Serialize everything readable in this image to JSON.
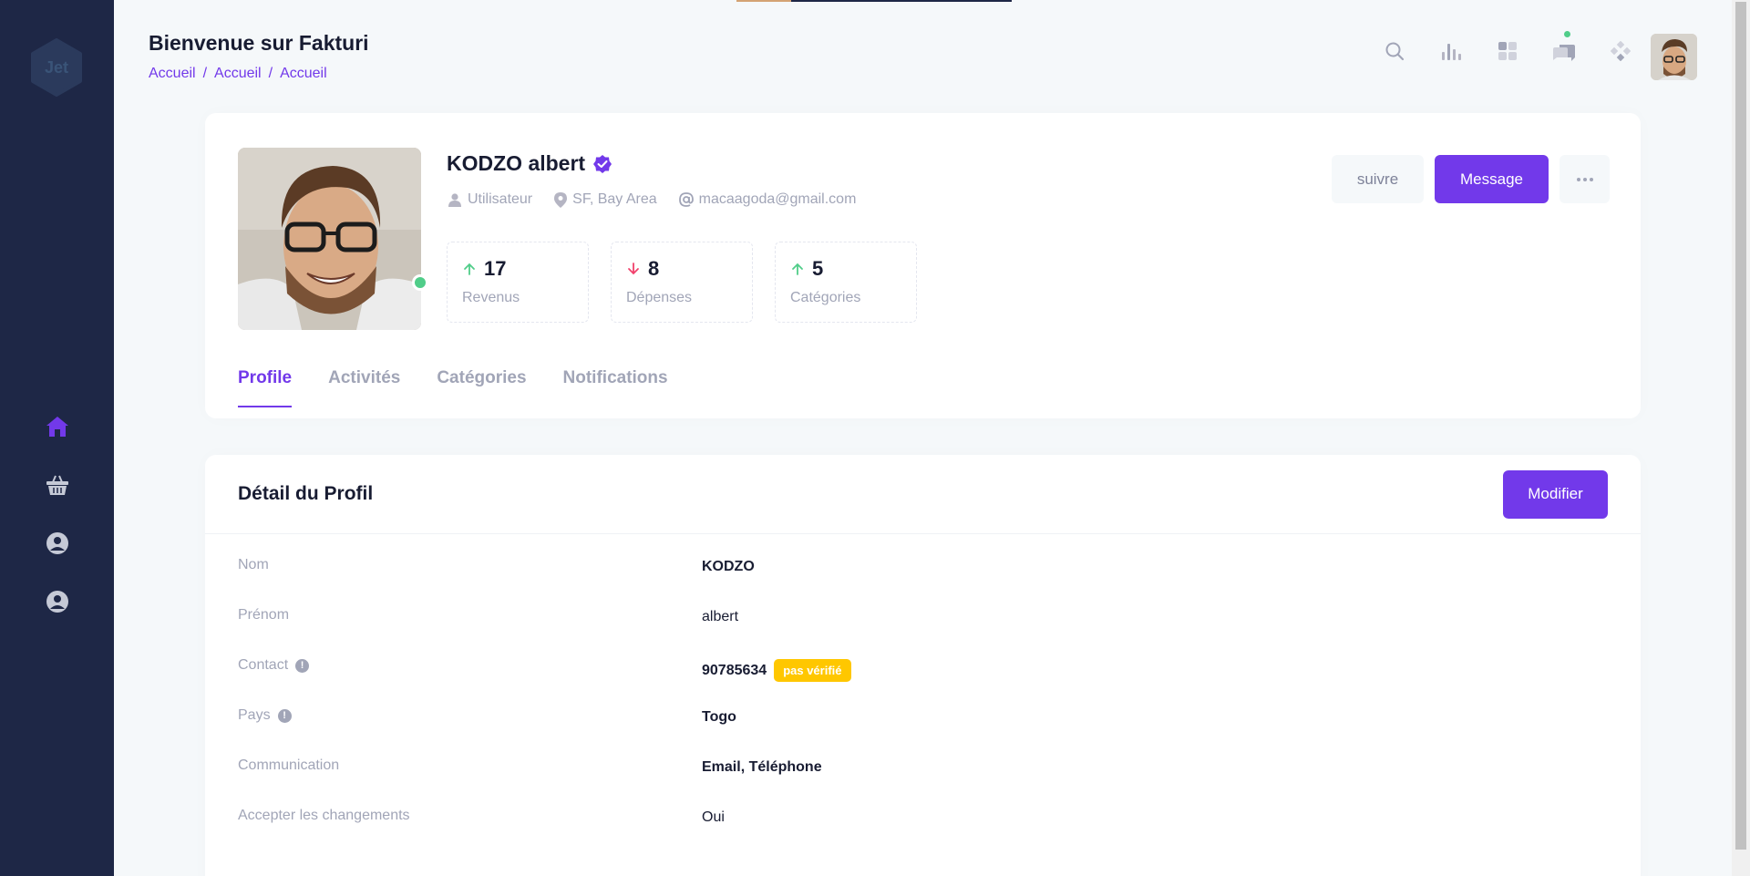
{
  "app": {
    "logo_text": "Jet"
  },
  "header": {
    "title": "Bienvenue sur Fakturi",
    "breadcrumb": [
      "Accueil",
      "Accueil",
      "Accueil"
    ]
  },
  "header_icons": [
    "search-icon",
    "chart-bar-icon",
    "grid-icon",
    "chat-icon",
    "diamond-apps-icon"
  ],
  "sidebar": {
    "items": [
      {
        "icon": "home-icon",
        "active": true
      },
      {
        "icon": "basket-icon",
        "active": false
      },
      {
        "icon": "circle-user-icon",
        "active": false
      },
      {
        "icon": "circle-user-icon",
        "active": false
      }
    ]
  },
  "profile": {
    "name": "KODZO albert",
    "role": "Utilisateur",
    "location": "SF, Bay Area",
    "email": "macaagoda@gmail.com",
    "stats": [
      {
        "value": "17",
        "label": "Revenus",
        "trend": "up"
      },
      {
        "value": "8",
        "label": "Dépenses",
        "trend": "down"
      },
      {
        "value": "5",
        "label": "Catégories",
        "trend": "up"
      }
    ],
    "follow_label": "suivre",
    "message_label": "Message",
    "more_label": "···"
  },
  "tabs": [
    {
      "label": "Profile",
      "active": true
    },
    {
      "label": "Activités",
      "active": false
    },
    {
      "label": "Catégories",
      "active": false
    },
    {
      "label": "Notifications",
      "active": false
    }
  ],
  "details": {
    "title": "Détail du Profil",
    "edit_label": "Modifier",
    "rows": [
      {
        "key": "Nom",
        "value": "KODZO",
        "bold": true
      },
      {
        "key": "Prénom",
        "value": "albert",
        "bold": false
      },
      {
        "key": "Contact",
        "value": "90785634",
        "bold": true,
        "badge": "pas vérifié",
        "info": true
      },
      {
        "key": "Pays",
        "value": "Togo",
        "bold": true,
        "info": true
      },
      {
        "key": "Communication",
        "value": "Email, Téléphone",
        "bold": true
      },
      {
        "key": "Accepter les changements",
        "value": "Oui",
        "bold": false
      }
    ]
  },
  "colors": {
    "primary": "#7239ea",
    "sidebar": "#1e2746",
    "success": "#50cd89",
    "danger": "#f1416c",
    "warning": "#ffc700"
  }
}
